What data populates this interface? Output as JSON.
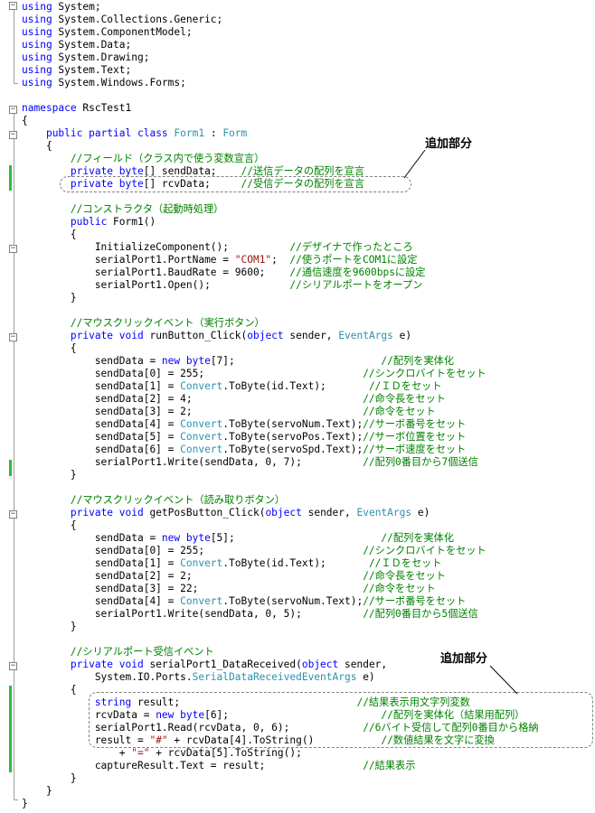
{
  "colors": {
    "keyword": "#0000ff",
    "type": "#2b91af",
    "string": "#a31515",
    "comment": "#008000",
    "text": "#000000",
    "change_bar": "#2ebd3a"
  },
  "code_lines": [
    [
      [
        "kw",
        "using"
      ],
      [
        "t",
        " System;"
      ]
    ],
    [
      [
        "kw",
        "using"
      ],
      [
        "t",
        " System.Collections.Generic;"
      ]
    ],
    [
      [
        "kw",
        "using"
      ],
      [
        "t",
        " System.ComponentModel;"
      ]
    ],
    [
      [
        "kw",
        "using"
      ],
      [
        "t",
        " System.Data;"
      ]
    ],
    [
      [
        "kw",
        "using"
      ],
      [
        "t",
        " System.Drawing;"
      ]
    ],
    [
      [
        "kw",
        "using"
      ],
      [
        "t",
        " System.Text;"
      ]
    ],
    [
      [
        "kw",
        "using"
      ],
      [
        "t",
        " System.Windows.Forms;"
      ]
    ],
    [],
    [
      [
        "kw",
        "namespace"
      ],
      [
        "t",
        " RscTest1"
      ]
    ],
    [
      [
        "t",
        "{"
      ]
    ],
    [
      [
        "t",
        "    "
      ],
      [
        "kw",
        "public partial class"
      ],
      [
        "t",
        " "
      ],
      [
        "ty",
        "Form1"
      ],
      [
        "t",
        " : "
      ],
      [
        "ty",
        "Form"
      ]
    ],
    [
      [
        "t",
        "    {"
      ]
    ],
    [
      [
        "t",
        "        "
      ],
      [
        "cm",
        "//フィールド（クラス内で使う変数宣言）"
      ]
    ],
    [
      [
        "t",
        "        "
      ],
      [
        "kw",
        "private byte"
      ],
      [
        "t",
        "[] sendData;    "
      ],
      [
        "cm",
        "//送信データの配列を宣言"
      ]
    ],
    [
      [
        "t",
        "        "
      ],
      [
        "kw",
        "private byte"
      ],
      [
        "t",
        "[] rcvData;     "
      ],
      [
        "cm",
        "//受信データの配列を宣言"
      ]
    ],
    [],
    [
      [
        "t",
        "        "
      ],
      [
        "cm",
        "//コンストラクタ（起動時処理）"
      ]
    ],
    [
      [
        "t",
        "        "
      ],
      [
        "kw",
        "public"
      ],
      [
        "t",
        " Form1()"
      ]
    ],
    [
      [
        "t",
        "        {"
      ]
    ],
    [
      [
        "t",
        "            InitializeComponent();          "
      ],
      [
        "cm",
        "//デザイナで作ったところ"
      ]
    ],
    [
      [
        "t",
        "            serialPort1.PortName = "
      ],
      [
        "str",
        "\"COM1\""
      ],
      [
        "t",
        ";  "
      ],
      [
        "cm",
        "//使うポートをCOM1に設定"
      ]
    ],
    [
      [
        "t",
        "            serialPort1.BaudRate = 9600;    "
      ],
      [
        "cm",
        "//通信速度を9600bpsに設定"
      ]
    ],
    [
      [
        "t",
        "            serialPort1.Open();             "
      ],
      [
        "cm",
        "//シリアルポートをオープン"
      ]
    ],
    [
      [
        "t",
        "        }"
      ]
    ],
    [],
    [
      [
        "t",
        "        "
      ],
      [
        "cm",
        "//マウスクリックイベント（実行ボタン）"
      ]
    ],
    [
      [
        "t",
        "        "
      ],
      [
        "kw",
        "private void"
      ],
      [
        "t",
        " runButton_Click("
      ],
      [
        "kw",
        "object"
      ],
      [
        "t",
        " sender, "
      ],
      [
        "ty",
        "EventArgs"
      ],
      [
        "t",
        " e)"
      ]
    ],
    [
      [
        "t",
        "        {"
      ]
    ],
    [
      [
        "t",
        "            sendData = "
      ],
      [
        "kw",
        "new byte"
      ],
      [
        "t",
        "[7];                        "
      ],
      [
        "cm",
        "//配列を実体化"
      ]
    ],
    [
      [
        "t",
        "            sendData[0] = 255;                          "
      ],
      [
        "cm",
        "//シンクロバイトをセット"
      ]
    ],
    [
      [
        "t",
        "            sendData[1] = "
      ],
      [
        "ty",
        "Convert"
      ],
      [
        "t",
        ".ToByte(id.Text);       "
      ],
      [
        "cm",
        "//ＩＤをセット"
      ]
    ],
    [
      [
        "t",
        "            sendData[2] = 4;                            "
      ],
      [
        "cm",
        "//命令長をセット"
      ]
    ],
    [
      [
        "t",
        "            sendData[3] = 2;                            "
      ],
      [
        "cm",
        "//命令をセット"
      ]
    ],
    [
      [
        "t",
        "            sendData[4] = "
      ],
      [
        "ty",
        "Convert"
      ],
      [
        "t",
        ".ToByte(servoNum.Text);"
      ],
      [
        "cm",
        "//サーボ番号をセット"
      ]
    ],
    [
      [
        "t",
        "            sendData[5] = "
      ],
      [
        "ty",
        "Convert"
      ],
      [
        "t",
        ".ToByte(servoPos.Text);"
      ],
      [
        "cm",
        "//サーボ位置をセット"
      ]
    ],
    [
      [
        "t",
        "            sendData[6] = "
      ],
      [
        "ty",
        "Convert"
      ],
      [
        "t",
        ".ToByte(servoSpd.Text);"
      ],
      [
        "cm",
        "//サーボ速度をセット"
      ]
    ],
    [
      [
        "t",
        "            serialPort1.Write(sendData, 0, 7);          "
      ],
      [
        "cm",
        "//配列0番目から7個送信"
      ]
    ],
    [
      [
        "t",
        "        }"
      ]
    ],
    [],
    [
      [
        "t",
        "        "
      ],
      [
        "cm",
        "//マウスクリックイベント（読み取りボタン）"
      ]
    ],
    [
      [
        "t",
        "        "
      ],
      [
        "kw",
        "private void"
      ],
      [
        "t",
        " getPosButton_Click("
      ],
      [
        "kw",
        "object"
      ],
      [
        "t",
        " sender, "
      ],
      [
        "ty",
        "EventArgs"
      ],
      [
        "t",
        " e)"
      ]
    ],
    [
      [
        "t",
        "        {"
      ]
    ],
    [
      [
        "t",
        "            sendData = "
      ],
      [
        "kw",
        "new byte"
      ],
      [
        "t",
        "[5];                        "
      ],
      [
        "cm",
        "//配列を実体化"
      ]
    ],
    [
      [
        "t",
        "            sendData[0] = 255;                          "
      ],
      [
        "cm",
        "//シンクロバイトをセット"
      ]
    ],
    [
      [
        "t",
        "            sendData[1] = "
      ],
      [
        "ty",
        "Convert"
      ],
      [
        "t",
        ".ToByte(id.Text);       "
      ],
      [
        "cm",
        "//ＩＤをセット"
      ]
    ],
    [
      [
        "t",
        "            sendData[2] = 2;                            "
      ],
      [
        "cm",
        "//命令長をセット"
      ]
    ],
    [
      [
        "t",
        "            sendData[3] = 22;                           "
      ],
      [
        "cm",
        "//命令をセット"
      ]
    ],
    [
      [
        "t",
        "            sendData[4] = "
      ],
      [
        "ty",
        "Convert"
      ],
      [
        "t",
        ".ToByte(servoNum.Text);"
      ],
      [
        "cm",
        "//サーボ番号をセット"
      ]
    ],
    [
      [
        "t",
        "            serialPort1.Write(sendData, 0, 5);          "
      ],
      [
        "cm",
        "//配列0番目から5個送信"
      ]
    ],
    [
      [
        "t",
        "        }"
      ]
    ],
    [],
    [
      [
        "t",
        "        "
      ],
      [
        "cm",
        "//シリアルポート受信イベント"
      ]
    ],
    [
      [
        "t",
        "        "
      ],
      [
        "kw",
        "private void"
      ],
      [
        "t",
        " serialPort1_DataReceived("
      ],
      [
        "kw",
        "object"
      ],
      [
        "t",
        " sender,"
      ]
    ],
    [
      [
        "t",
        "            System.IO.Ports."
      ],
      [
        "ty",
        "SerialDataReceivedEventArgs"
      ],
      [
        "t",
        " e)"
      ]
    ],
    [
      [
        "t",
        "        {"
      ]
    ],
    [
      [
        "t",
        "            "
      ],
      [
        "kw",
        "string"
      ],
      [
        "t",
        " result;                             "
      ],
      [
        "cm",
        "//結果表示用文字列変数"
      ]
    ],
    [
      [
        "t",
        "            rcvData = "
      ],
      [
        "kw",
        "new byte"
      ],
      [
        "t",
        "[6];                         "
      ],
      [
        "cm",
        "//配列を実体化（結果用配列）"
      ]
    ],
    [
      [
        "t",
        "            serialPort1.Read(rcvData, 0, 6);            "
      ],
      [
        "cm",
        "//6バイト受信して配列0番目から格納"
      ]
    ],
    [
      [
        "t",
        "            result = "
      ],
      [
        "str",
        "\"#\""
      ],
      [
        "t",
        " + rcvData[4].ToString()           "
      ],
      [
        "cm",
        "//数値結果を文字に変換"
      ]
    ],
    [
      [
        "t",
        "                + "
      ],
      [
        "str",
        "\"=\""
      ],
      [
        "t",
        " + rcvData[5].ToString();"
      ]
    ],
    [
      [
        "t",
        "            captureResult.Text = result;                "
      ],
      [
        "cm",
        "//結果表示"
      ]
    ],
    [
      [
        "t",
        "        }"
      ]
    ],
    [
      [
        "t",
        "    }"
      ]
    ],
    [
      [
        "t",
        "}"
      ]
    ]
  ],
  "callouts": [
    {
      "label": "追加部分"
    },
    {
      "label": "追加部分"
    }
  ]
}
